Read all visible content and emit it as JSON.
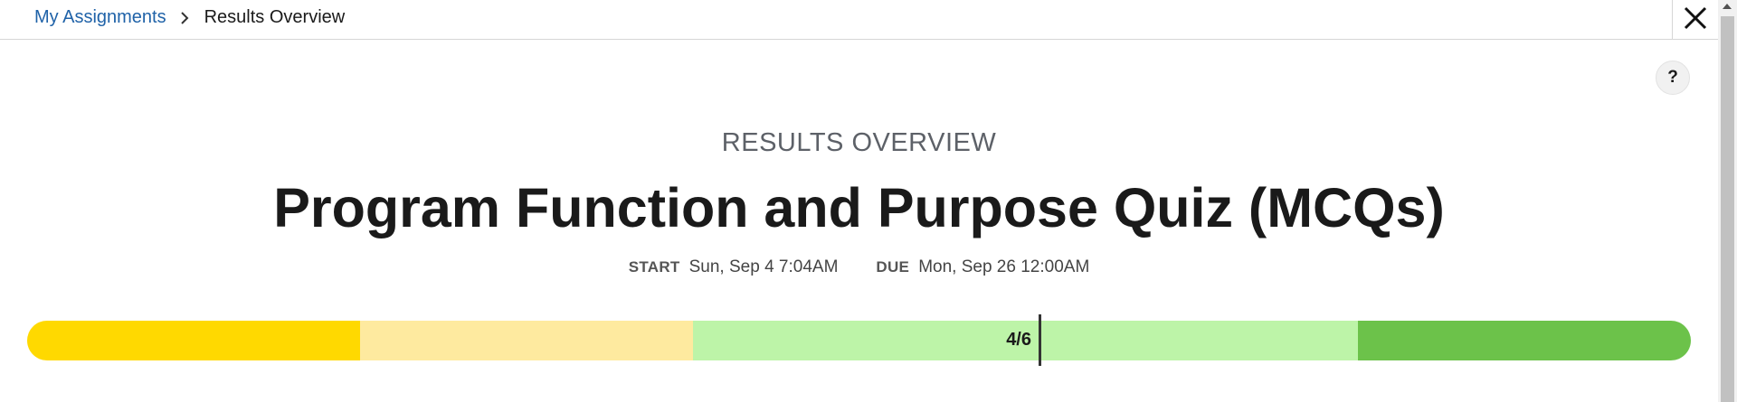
{
  "breadcrumb": {
    "parent": "My Assignments",
    "current": "Results Overview"
  },
  "header": {
    "eyebrow": "RESULTS OVERVIEW",
    "title": "Program Function and Purpose Quiz (MCQs)",
    "start_label": "START",
    "start_value": "Sun, Sep 4 7:04AM",
    "due_label": "DUE",
    "due_value": "Mon, Sep 26 12:00AM"
  },
  "help": {
    "label": "?"
  },
  "score": {
    "text": "4/6",
    "correct": 4,
    "total": 6,
    "fraction": 0.6667
  },
  "progress_segments": [
    {
      "color": "#ffd900"
    },
    {
      "color": "#feea9f"
    },
    {
      "color": "#bdf4a8"
    },
    {
      "color": "#bdf4a8"
    },
    {
      "color": "#6cc24a"
    }
  ],
  "icons": {
    "close": "close-icon",
    "breadcrumb_separator": "chevron-right-icon"
  },
  "colors": {
    "link": "#1f62a8"
  }
}
